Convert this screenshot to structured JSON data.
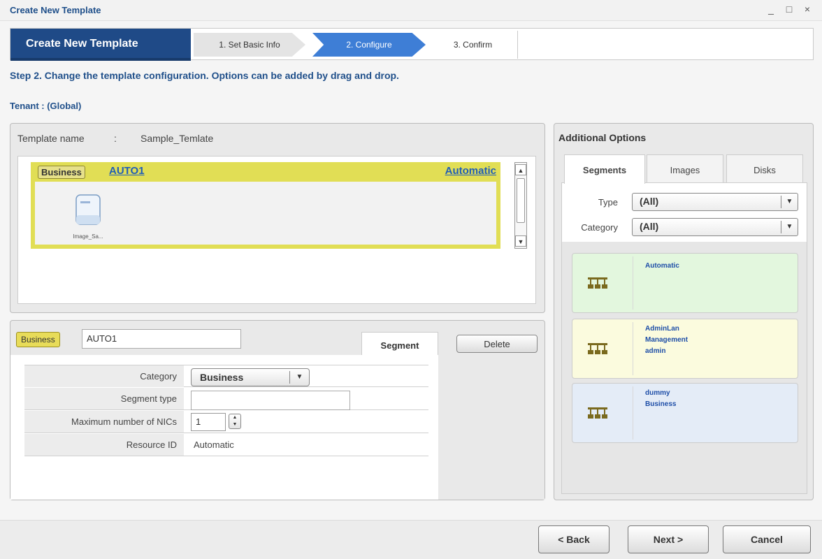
{
  "window": {
    "title": "Create New Template",
    "minimize": "_",
    "maximize": "□",
    "close": "×"
  },
  "wizard": {
    "main": "Create New Template",
    "steps": [
      "1. Set Basic Info",
      "2. Configure",
      "3. Confirm"
    ],
    "active_step": 1
  },
  "instruction": "Step 2. Change the template configuration.  Options can be added by drag and drop.",
  "tenant": "Tenant : (Global)",
  "template": {
    "name_label": "Template name",
    "colon": ":",
    "name_value": "Sample_Temlate",
    "segment": {
      "category_tag": "Business",
      "name": "AUTO1",
      "mode": "Automatic",
      "image_label": "Image_Sa..."
    }
  },
  "details": {
    "category_tag": "Business",
    "name_value": "AUTO1",
    "tab": "Segment",
    "delete": "Delete",
    "rows": {
      "category": {
        "label": "Category",
        "value": "Business"
      },
      "segment_type": {
        "label": "Segment type",
        "value": ""
      },
      "max_nics": {
        "label": "Maximum number of NICs",
        "value": "1"
      },
      "resource_id": {
        "label": "Resource ID",
        "value": "Automatic"
      }
    }
  },
  "additional": {
    "title": "Additional Options",
    "tabs": [
      "Segments",
      "Images",
      "Disks"
    ],
    "active_tab": 0,
    "filters": {
      "type": {
        "label": "Type",
        "value": "(All)"
      },
      "category": {
        "label": "Category",
        "value": "(All)"
      }
    },
    "cards": [
      {
        "lines": [
          "Automatic"
        ],
        "color": "#e3f7de"
      },
      {
        "lines": [
          "AdminLan",
          "Management",
          "admin"
        ],
        "color": "#fbfbde"
      },
      {
        "lines": [
          "dummy",
          "Business"
        ],
        "color": "#e4ecf7"
      }
    ]
  },
  "footer": {
    "back": "< Back",
    "next": "Next >",
    "cancel": "Cancel"
  },
  "colors": {
    "accent": "#1f4a87",
    "active_step": "#3e7ed6",
    "segment_border": "#e1de55",
    "link": "#1f5db8"
  }
}
